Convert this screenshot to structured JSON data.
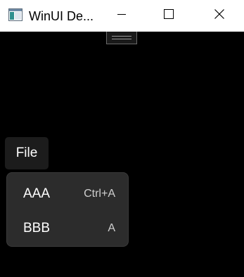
{
  "window": {
    "title": "WinUI De...",
    "app_icon": "app-window-icon",
    "minimize_icon": "minimize-icon",
    "maximize_icon": "maximize-icon",
    "close_icon": "close-icon"
  },
  "menubar": {
    "items": [
      {
        "label": "File"
      }
    ]
  },
  "flyout": {
    "items": [
      {
        "label": "AAA",
        "accelerator": "Ctrl+A"
      },
      {
        "label": "BBB",
        "accelerator": "A"
      }
    ]
  },
  "colors": {
    "background": "#000000",
    "titlebar": "#ffffff",
    "menubar_item": "#1c1c1c",
    "flyout": "#2c2c2c"
  }
}
